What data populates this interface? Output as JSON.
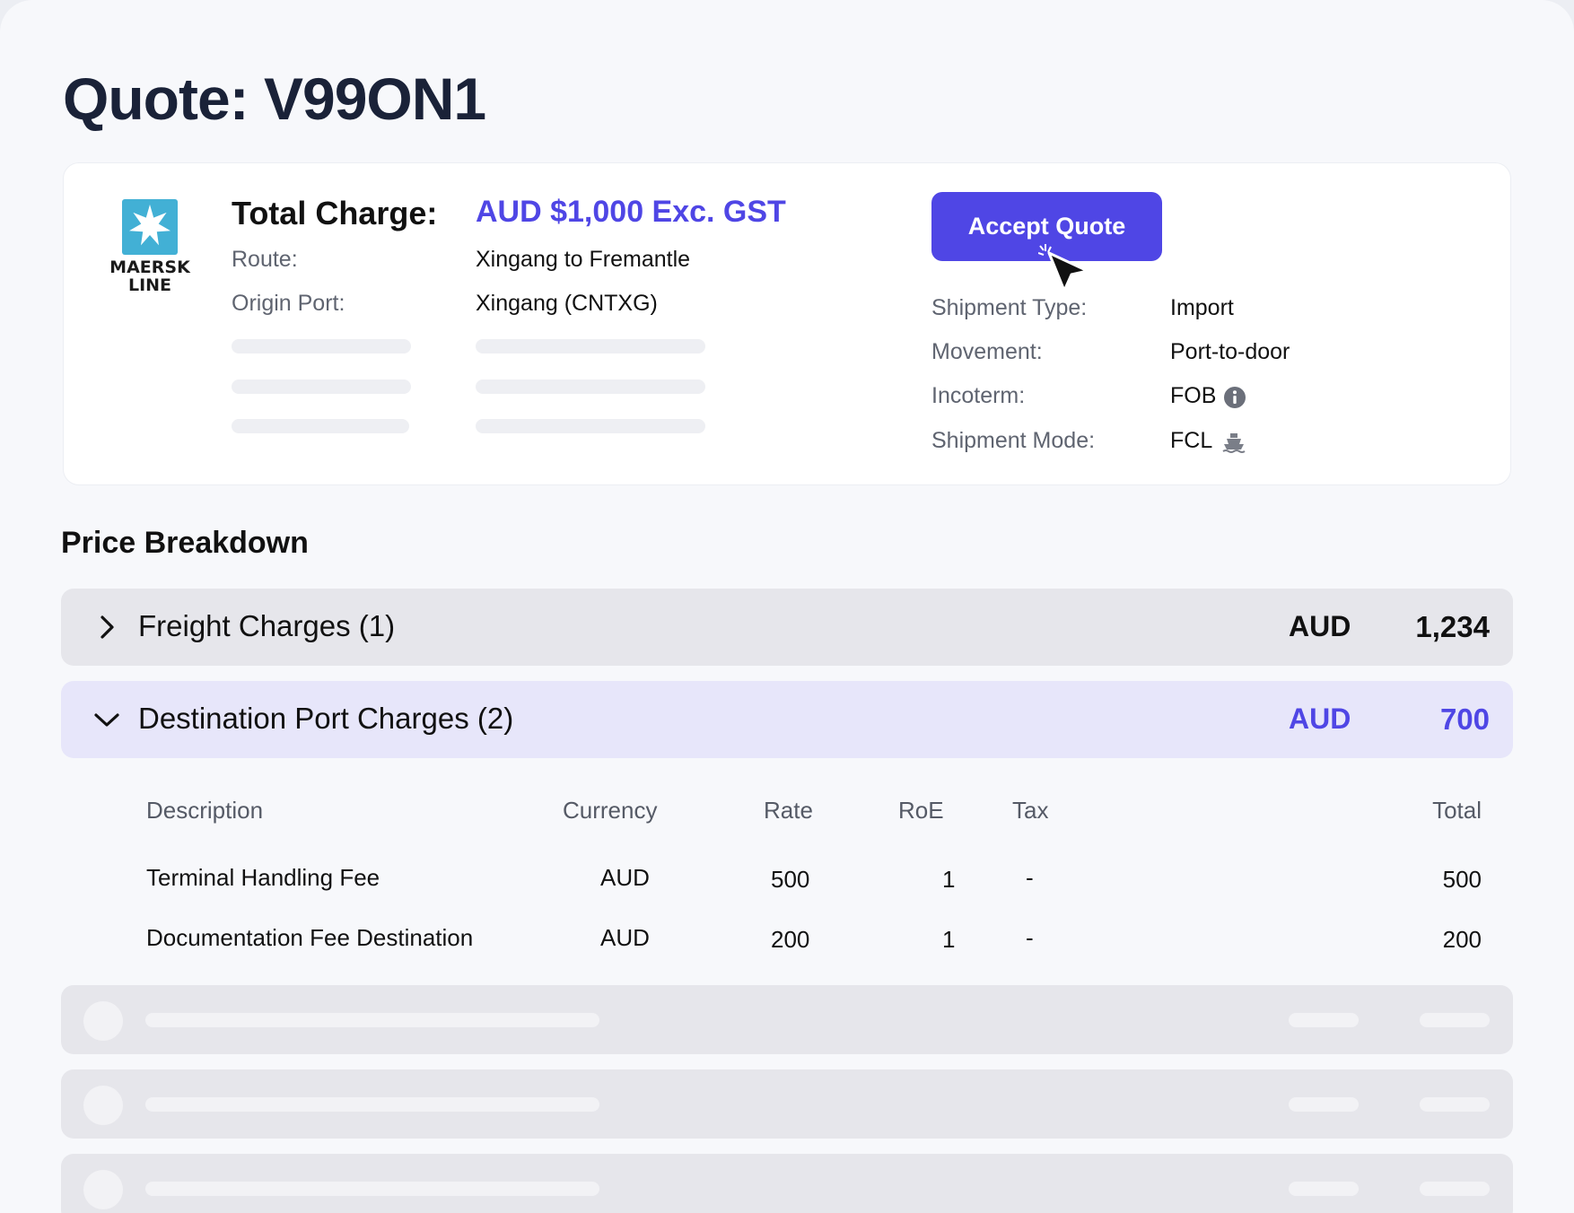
{
  "page": {
    "title": "Quote: V99ON1"
  },
  "summary": {
    "carrier_logo": {
      "line1": "MAERSK",
      "line2": "LINE",
      "icon": "star-icon",
      "brand_color": "#42b0d5"
    },
    "total_label": "Total Charge:",
    "total_value": "AUD $1,000 Exc. GST",
    "route_label": "Route:",
    "route_value": "Xingang to Fremantle",
    "origin_label": "Origin Port:",
    "origin_value": "Xingang (CNTXG)",
    "accept_button": "Accept Quote",
    "shipment_type_label": "Shipment Type:",
    "shipment_type_value": "Import",
    "movement_label": "Movement:",
    "movement_value": "Port-to-door",
    "incoterm_label": "Incoterm:",
    "incoterm_value": "FOB",
    "incoterm_icon": "info-icon",
    "mode_label": "Shipment Mode:",
    "mode_value": "FCL",
    "mode_icon": "ship-icon"
  },
  "breakdown": {
    "title": "Price Breakdown",
    "groups": [
      {
        "title": "Freight Charges (1)",
        "currency": "AUD",
        "amount": "1,234",
        "state": "collapsed",
        "icon": "chevron-right-icon"
      },
      {
        "title": "Destination Port Charges (2)",
        "currency": "AUD",
        "amount": "700",
        "state": "expanded",
        "icon": "chevron-down-icon"
      }
    ],
    "table": {
      "headers": {
        "description": "Description",
        "currency": "Currency",
        "rate": "Rate",
        "roe": "RoE",
        "tax": "Tax",
        "total": "Total"
      },
      "rows": [
        {
          "description": "Terminal Handling Fee",
          "currency": "AUD",
          "rate": "500",
          "roe": "1",
          "tax": "-",
          "total": "500"
        },
        {
          "description": "Documentation Fee Destination",
          "currency": "AUD",
          "rate": "200",
          "roe": "1",
          "tax": "-",
          "total": "200"
        }
      ]
    }
  },
  "colors": {
    "accent": "#4f46e5",
    "expanded_row_bg": "#e7e6fa",
    "collapsed_row_bg": "#e6e6eb",
    "title": "#1a2238"
  }
}
